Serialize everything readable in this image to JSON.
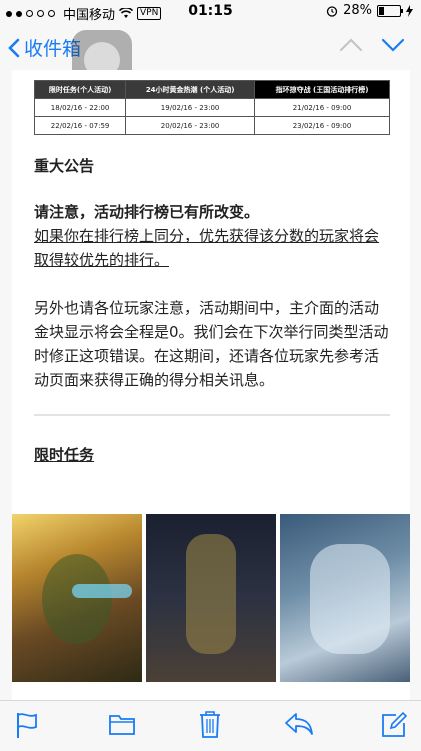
{
  "status_bar": {
    "carrier": "中国移动",
    "vpn": "VPN",
    "time": "01:15",
    "battery_percent": "28%",
    "battery_level": 0.28
  },
  "nav": {
    "back_label": "收件箱"
  },
  "table": {
    "headers": [
      "限时任务(个人活动)",
      "24小时黄金热潮 (个人活动)",
      "指环掠夺战 (王国活动排行榜)"
    ],
    "rows": [
      [
        "18/02/16 - 22:00",
        "19/02/16 - 23:00",
        "21/02/16 - 09:00"
      ],
      [
        "22/02/16 - 07:59",
        "20/02/16 - 23:00",
        "23/02/16 - 09:00"
      ]
    ]
  },
  "content": {
    "announcement_title": "重大公告",
    "notice_bold": "请注意，活动排行榜已有所改变。",
    "notice_underline": "如果你在排行榜上同分，优先获得该分数的玩家将会取得较优先的排行。",
    "notice_para": "另外也请各位玩家注意，活动期间中，主介面的活动金块显示将会全程是0。我们会在下次举行同类型活动时修正这项错误。在这期间，还请各位玩家先参考活动页面来获得正确的得分相关讯息。",
    "mission_title": "限时任务"
  },
  "colors": {
    "accent": "#1a7cf5",
    "table_header": "#3a3a3a"
  },
  "toolbar": {
    "icons": [
      "flag-icon",
      "folder-icon",
      "trash-icon",
      "reply-icon",
      "compose-icon"
    ]
  }
}
